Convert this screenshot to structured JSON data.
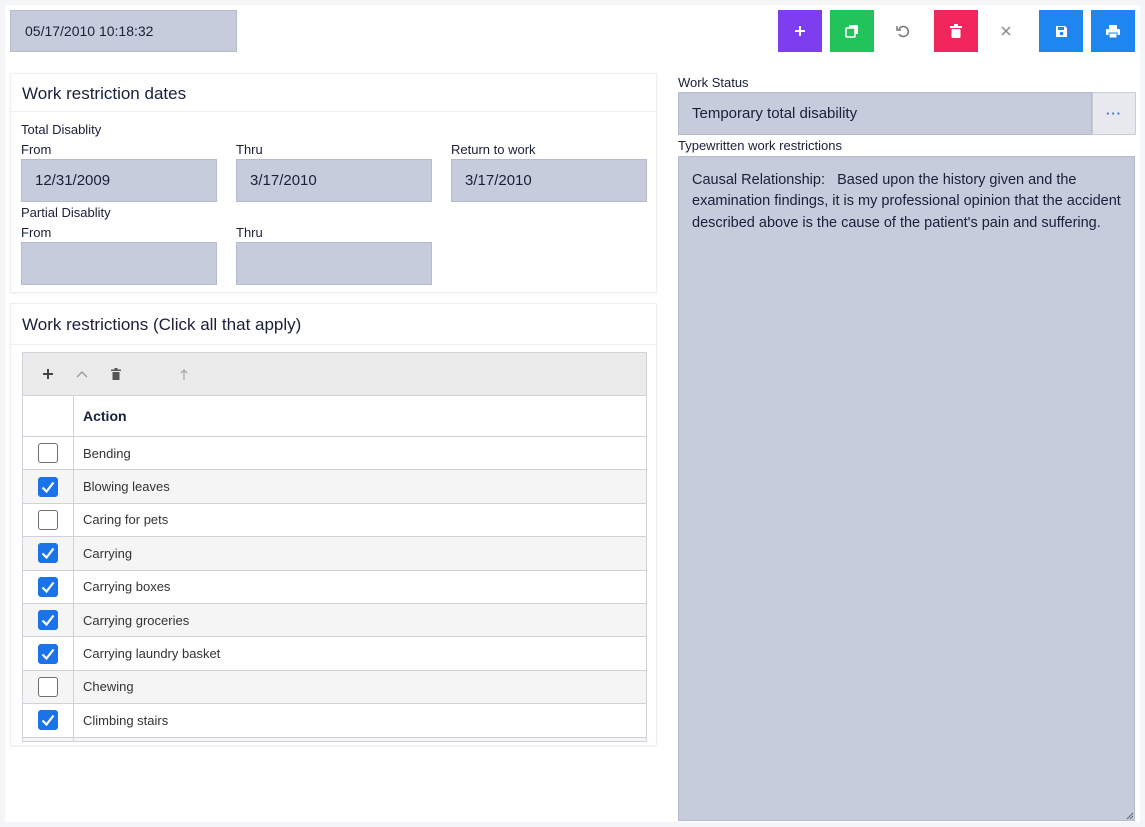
{
  "header": {
    "timestamp": "05/17/2010 10:18:32"
  },
  "toolbar": {
    "add": {
      "icon": "plus-icon",
      "color": "#7e3ef0"
    },
    "copy": {
      "icon": "copy-icon",
      "color": "#22c35a"
    },
    "undo": {
      "icon": "undo-icon"
    },
    "delete": {
      "icon": "trash-icon",
      "color": "#f0265d"
    },
    "close": {
      "icon": "close-icon"
    },
    "save": {
      "icon": "save-icon",
      "color": "#1e87ef"
    },
    "print": {
      "icon": "print-icon",
      "color": "#1e87ef"
    }
  },
  "dates_card": {
    "title": "Work restriction dates",
    "total_label": "Total Disablity",
    "from_label": "From",
    "thru_label": "Thru",
    "return_label": "Return to work",
    "total_from": "12/31/2009",
    "total_thru": "3/17/2010",
    "return_to_work": "3/17/2010",
    "partial_label": "Partial Disablity",
    "partial_from_label": "From",
    "partial_thru_label": "Thru",
    "partial_from": "",
    "partial_thru": ""
  },
  "restrictions_card": {
    "title": "Work restrictions (Click all that apply)",
    "column_header": "Action",
    "rows": [
      {
        "label": "Bending",
        "checked": false
      },
      {
        "label": "Blowing leaves",
        "checked": true
      },
      {
        "label": "Caring for pets",
        "checked": false
      },
      {
        "label": "Carrying",
        "checked": true
      },
      {
        "label": "Carrying boxes",
        "checked": true
      },
      {
        "label": "Carrying groceries",
        "checked": true
      },
      {
        "label": "Carrying laundry basket",
        "checked": true
      },
      {
        "label": "Chewing",
        "checked": false
      },
      {
        "label": "Climbing stairs",
        "checked": true
      }
    ]
  },
  "work_status": {
    "label": "Work Status",
    "value": "Temporary total disability",
    "more_label": "···"
  },
  "typewritten": {
    "label": "Typewritten work restrictions",
    "text": "Causal Relationship:   Based upon the history given and the examination findings, it is my professional opinion that the accident described above is the cause of the patient's pain and suffering."
  }
}
